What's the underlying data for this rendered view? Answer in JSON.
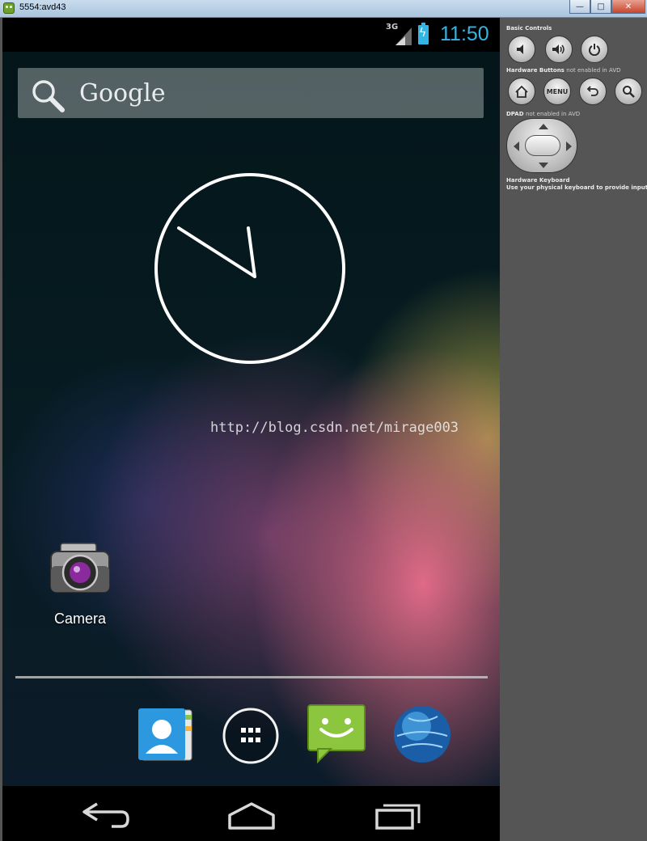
{
  "window": {
    "title": "5554:avd43",
    "minimize": "—",
    "maximize": "□",
    "close": "✕"
  },
  "statusbar": {
    "network": "3G",
    "time": "11:50",
    "battery_glyph": "ϟ",
    "accent_color": "#33b5e5"
  },
  "search": {
    "label": "Google",
    "icon": "search-icon"
  },
  "homescreen": {
    "watermark": "http://blog.csdn.net/mirage003",
    "shortcuts": [
      {
        "label": "Camera",
        "icon": "camera-icon"
      }
    ]
  },
  "dock": {
    "icons": [
      "contacts-icon",
      "all-apps-icon",
      "messaging-icon",
      "browser-icon"
    ]
  },
  "navbar": {
    "buttons": [
      "back-icon",
      "home-icon",
      "recent-apps-icon"
    ]
  },
  "controls": {
    "basic_heading": "Basic Controls",
    "basic_buttons": [
      "volume-down-icon",
      "volume-up-icon",
      "power-icon"
    ],
    "hardware_heading": "Hardware Buttons",
    "hardware_note": "not enabled in AVD",
    "hardware_buttons": [
      "home-icon",
      "MENU",
      "back-icon",
      "search-icon"
    ],
    "menu_label": "MENU",
    "dpad_heading": "DPAD",
    "dpad_note": "not enabled in AVD",
    "keyboard_heading": "Hardware Keyboard",
    "keyboard_note": "Use your physical keyboard to provide input"
  }
}
